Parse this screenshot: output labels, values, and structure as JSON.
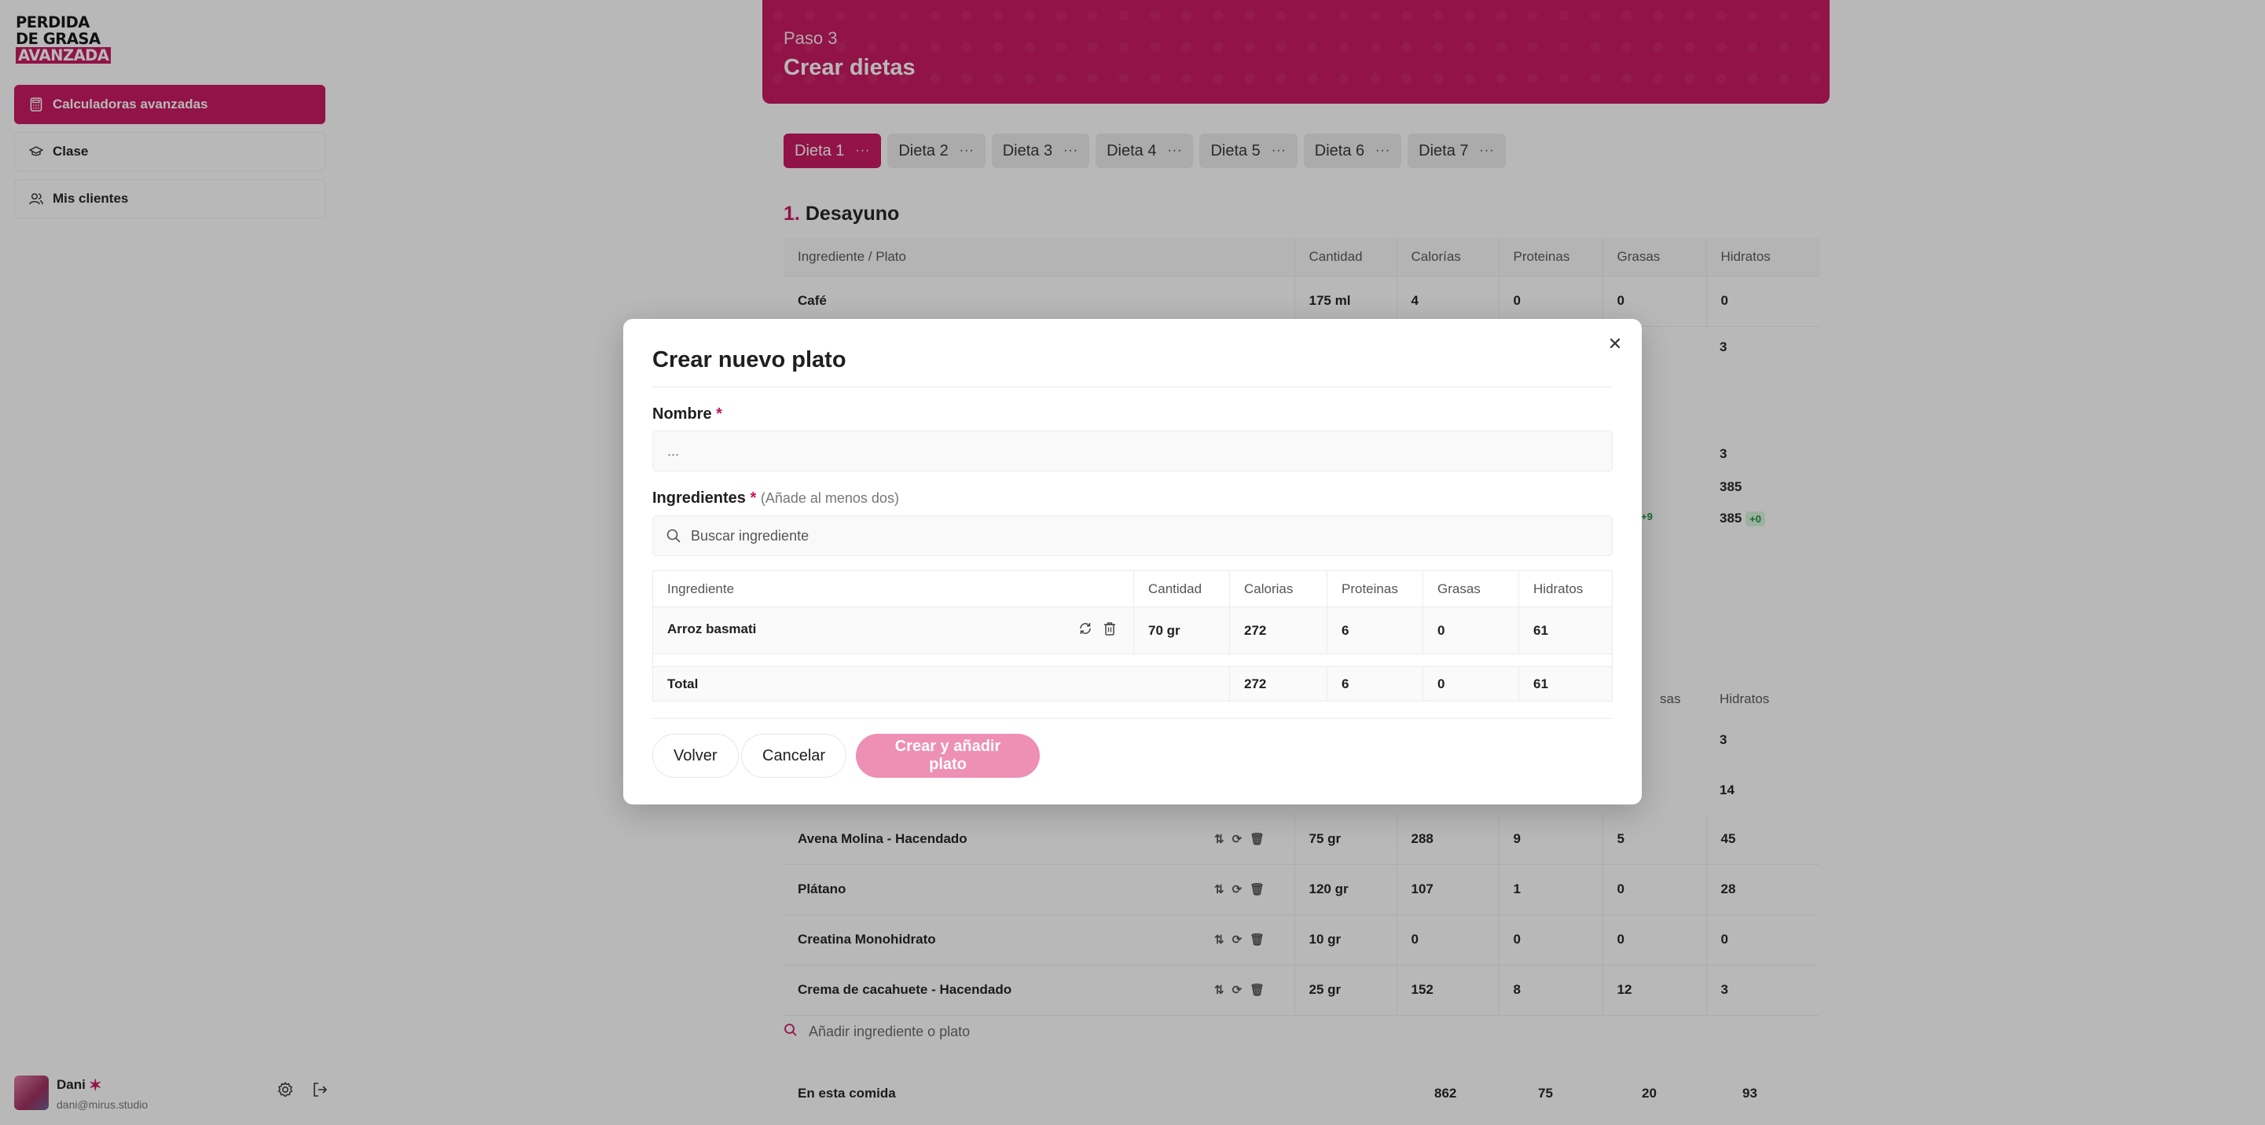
{
  "app": {
    "logo_lines": [
      "PERDIDA",
      "DE GRASA",
      "AVANZADA"
    ]
  },
  "sidebar": {
    "items": [
      {
        "label": "Calculadoras avanzadas",
        "icon": "calculator-icon",
        "active": true
      },
      {
        "label": "Clase",
        "icon": "graduation-cap-icon",
        "active": false
      },
      {
        "label": "Mis clientes",
        "icon": "users-icon",
        "active": false
      }
    ],
    "user": {
      "name": "Dani",
      "email": "dani@mirus.studio"
    }
  },
  "header": {
    "step": "Paso 3",
    "title": "Crear dietas"
  },
  "tabs": [
    "Dieta 1",
    "Dieta 2",
    "Dieta 3",
    "Dieta 4",
    "Dieta 5",
    "Dieta 6",
    "Dieta 7"
  ],
  "meal": {
    "number": "1.",
    "name": "Desayuno",
    "columns": [
      "Ingrediente / Plato",
      "Cantidad",
      "Calorías",
      "Proteinas",
      "Grasas",
      "Hidratos"
    ],
    "first_row": {
      "name": "Café",
      "qty": "175 ml",
      "cal": "4",
      "prot": "0",
      "fat": "0",
      "carb": "0"
    },
    "partial_values": [
      "3",
      "3",
      "385",
      "385",
      "+0",
      "+9"
    ]
  },
  "meal2": {
    "columns_tail": [
      "sas",
      "Hidratos"
    ],
    "partial_values": [
      "3",
      "14"
    ],
    "rows": [
      {
        "name": "Avena Molina - Hacendado",
        "qty": "75 gr",
        "cal": "288",
        "prot": "9",
        "fat": "5",
        "carb": "45"
      },
      {
        "name": "Plátano",
        "qty": "120 gr",
        "cal": "107",
        "prot": "1",
        "fat": "0",
        "carb": "28"
      },
      {
        "name": "Creatina Monohidrato",
        "qty": "10 gr",
        "cal": "0",
        "prot": "0",
        "fat": "0",
        "carb": "0"
      },
      {
        "name": "Crema de cacahuete - Hacendado",
        "qty": "25 gr",
        "cal": "152",
        "prot": "8",
        "fat": "12",
        "carb": "3"
      }
    ],
    "add_placeholder": "Añadir ingrediente o plato",
    "totals_label": "En esta comida",
    "totals": {
      "cal": "862",
      "prot": "75",
      "fat": "20",
      "carb": "93"
    }
  },
  "modal": {
    "title": "Crear nuevo plato",
    "name_label": "Nombre",
    "required_mark": "*",
    "name_placeholder": "...",
    "ingredients_label": "Ingredientes",
    "ingredients_hint": "(Añade al menos dos)",
    "search_placeholder": "Buscar ingrediente",
    "columns": [
      "Ingrediente",
      "Cantidad",
      "Calorias",
      "Proteinas",
      "Grasas",
      "Hidratos"
    ],
    "rows": [
      {
        "name": "Arroz basmati",
        "qty": "70 gr",
        "cal": "272",
        "prot": "6",
        "fat": "0",
        "carb": "61"
      }
    ],
    "total": {
      "label": "Total",
      "cal": "272",
      "prot": "6",
      "fat": "0",
      "carb": "61"
    },
    "buttons": {
      "back": "Volver",
      "cancel": "Cancelar",
      "create": "Crear y añadir plato"
    }
  },
  "colors": {
    "accent": "#c7145e",
    "primary_disabled": "#ee8fb4"
  }
}
